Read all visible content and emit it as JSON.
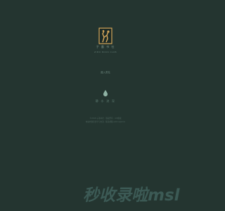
{
  "brand": {
    "name": "子 墨 书 社",
    "tagline": "ZIMO BOOK CLUB",
    "logo_icon": "tree-logo-icon",
    "logo_color": "#d6a85c"
  },
  "main": {
    "link_label": "進入書社"
  },
  "icon_section": {
    "icon": "droplet-icon",
    "caption": "静 水 流 深",
    "icon_color": "#8fb3a4"
  },
  "footer": {
    "line1": "©2018 子墨书社 · 版权所有 · ICP备案",
    "line2": "本站内容仅供学习交流 · 联系邮箱 admin@zimo"
  },
  "watermark": {
    "text": "秒收录啦msl"
  },
  "colors": {
    "background": "#243530",
    "accent": "#d6a85c"
  }
}
